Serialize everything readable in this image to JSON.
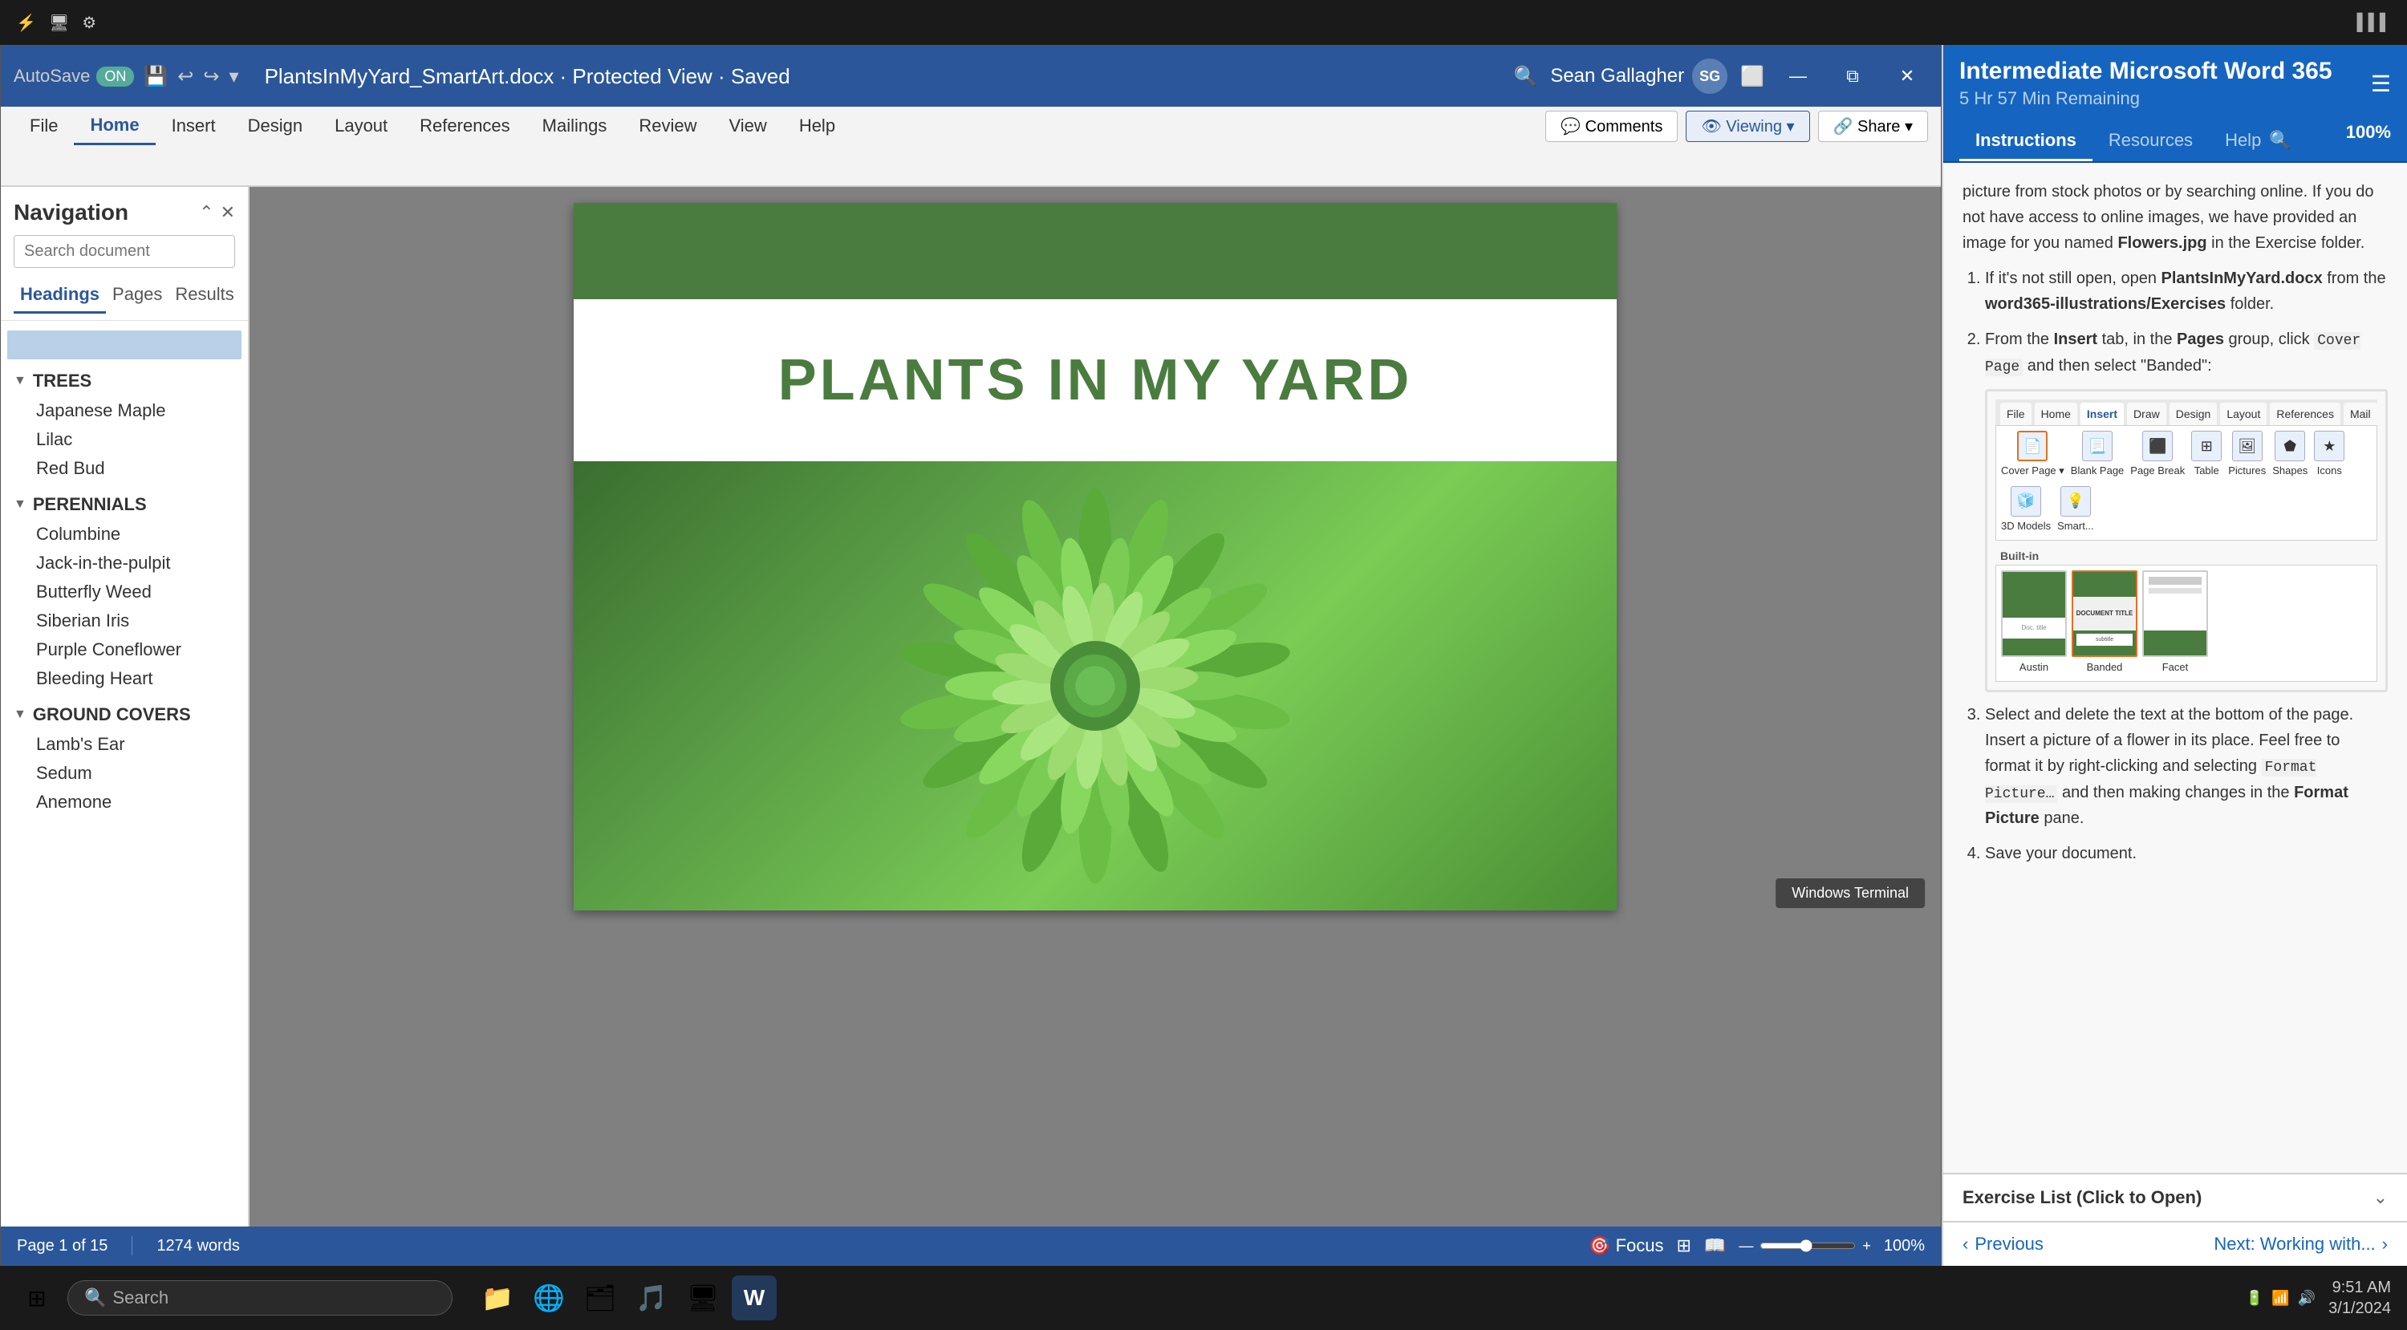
{
  "taskbar_top": {
    "icons": [
      "⚡",
      "🖥",
      "⚙"
    ]
  },
  "title_bar": {
    "autosave_label": "AutoSave",
    "autosave_state": "ON",
    "filename": "PlantsInMyYard_SmartArt.docx · Protected View · Saved",
    "user_name": "Sean Gallagher",
    "search_icon": "🔍"
  },
  "ribbon": {
    "tabs": [
      "File",
      "Home",
      "Insert",
      "Design",
      "Layout",
      "References",
      "Mailings",
      "Review",
      "View",
      "Help"
    ],
    "active_tab": "Home",
    "buttons": {
      "comments": "💬 Comments",
      "viewing": "👁 Viewing",
      "share": "🔗 Share"
    }
  },
  "navigation": {
    "title": "Navigation",
    "search_placeholder": "Search document",
    "tabs": [
      "Headings",
      "Pages",
      "Results"
    ],
    "active_tab": "Headings",
    "tree": [
      {
        "section": "TREES",
        "expanded": true,
        "items": [
          "Japanese Maple",
          "Lilac",
          "Red Bud"
        ]
      },
      {
        "section": "PERENNIALS",
        "expanded": true,
        "items": [
          "Columbine",
          "Jack-in-the-pulpit",
          "Butterfly Weed",
          "Siberian Iris",
          "Purple Coneflower",
          "Bleeding Heart"
        ]
      },
      {
        "section": "GROUND COVERS",
        "expanded": true,
        "items": [
          "Lamb's Ear",
          "Sedum",
          "Anemone"
        ]
      }
    ]
  },
  "document": {
    "title": "PLANTS IN MY YARD",
    "page_info": "Page 1 of 15",
    "word_count": "1274 words",
    "zoom": "100%"
  },
  "right_panel": {
    "title": "Intermediate Microsoft Word 365",
    "subtitle": "5 Hr 57 Min Remaining",
    "tabs": [
      "Instructions",
      "Resources",
      "Help"
    ],
    "active_tab": "Instructions",
    "content": {
      "intro": "picture from stock photos or by searching online. If you do not have access to online images, we have provided an image for you named Flowers.jpg in the Exercise folder.",
      "steps": [
        {
          "num": 1,
          "parts": [
            {
              "text": "If it's not still open, open ",
              "style": "normal"
            },
            {
              "text": "PlantsInMyYard.docx",
              "style": "bold"
            },
            {
              "text": " from the ",
              "style": "normal"
            },
            {
              "text": "word365-illustrations/Exercises",
              "style": "bold"
            },
            {
              "text": " folder.",
              "style": "normal"
            }
          ]
        },
        {
          "num": 2,
          "parts": [
            {
              "text": "From the ",
              "style": "normal"
            },
            {
              "text": "Insert",
              "style": "bold"
            },
            {
              "text": " tab, in the ",
              "style": "normal"
            },
            {
              "text": "Pages",
              "style": "bold"
            },
            {
              "text": " group, click ",
              "style": "normal"
            },
            {
              "text": "Cover Page",
              "style": "code"
            },
            {
              "text": " and then select \"Banded\":",
              "style": "normal"
            }
          ]
        },
        {
          "num": 3,
          "parts": [
            {
              "text": "Select and delete the text at the bottom of the page. Insert a picture of a flower in its place. Feel free to format it by right-clicking and selecting ",
              "style": "normal"
            },
            {
              "text": "Format Picture…",
              "style": "code"
            },
            {
              "text": " and then making changes in the ",
              "style": "normal"
            },
            {
              "text": "Format Picture",
              "style": "bold"
            },
            {
              "text": " pane.",
              "style": "normal"
            }
          ]
        },
        {
          "num": 4,
          "text": "Save your document."
        }
      ],
      "insert_ribbon": {
        "tabs": [
          "File",
          "Home",
          "Insert",
          "Draw",
          "Design",
          "Layout",
          "References",
          "Mail"
        ],
        "active_tab": "Insert",
        "buttons": [
          {
            "label": "Cover Page ▾",
            "icon": "📄",
            "active": true
          },
          {
            "label": "Blank Page",
            "icon": "📃",
            "active": false
          },
          {
            "label": "Page Break",
            "icon": "⬛",
            "active": false
          },
          {
            "label": "Table",
            "icon": "⊞",
            "active": false
          },
          {
            "label": "Pictures",
            "icon": "🖼",
            "active": false
          },
          {
            "label": "Shapes",
            "icon": "⬟",
            "active": false
          },
          {
            "label": "Icons",
            "icon": "★",
            "active": false
          },
          {
            "label": "3D Models",
            "icon": "🧊",
            "active": false
          },
          {
            "label": "Smart...",
            "icon": "💡",
            "active": false
          }
        ],
        "built_in_label": "Built-in",
        "thumbs": [
          {
            "label": "Austin",
            "selected": false
          },
          {
            "label": "Banded",
            "selected": true
          },
          {
            "label": "Facet",
            "selected": false
          }
        ]
      }
    },
    "exercise_list": {
      "label": "Exercise List (Click to Open)"
    },
    "bottom_nav": {
      "prev_label": "Previous",
      "next_label": "Next: Working with..."
    }
  },
  "taskbar_bottom": {
    "search_text": "Search",
    "time": "9:51 AM",
    "date": "3/1/2024",
    "apps": [
      "🗂",
      "🌐",
      "📁",
      "🎵",
      "🖥",
      "W"
    ]
  }
}
